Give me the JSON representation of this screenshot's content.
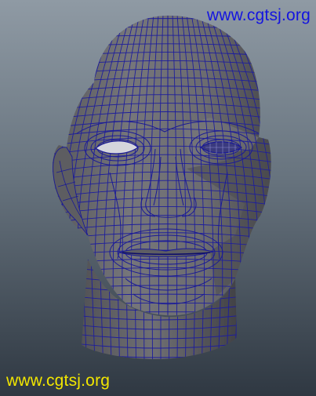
{
  "viewport": {
    "object": "head-mesh"
  },
  "watermarks": {
    "top": {
      "text": "www.cgtsj.org",
      "color": "#1414e0"
    },
    "bottom": {
      "text": "www.cgtsj.org",
      "color": "#f2e600"
    }
  },
  "colors": {
    "background_top": "#8f9aa4",
    "background_bottom": "#2f3842",
    "mesh_fill": "#6a6a6e",
    "wireframe": "#1e1e9c"
  }
}
